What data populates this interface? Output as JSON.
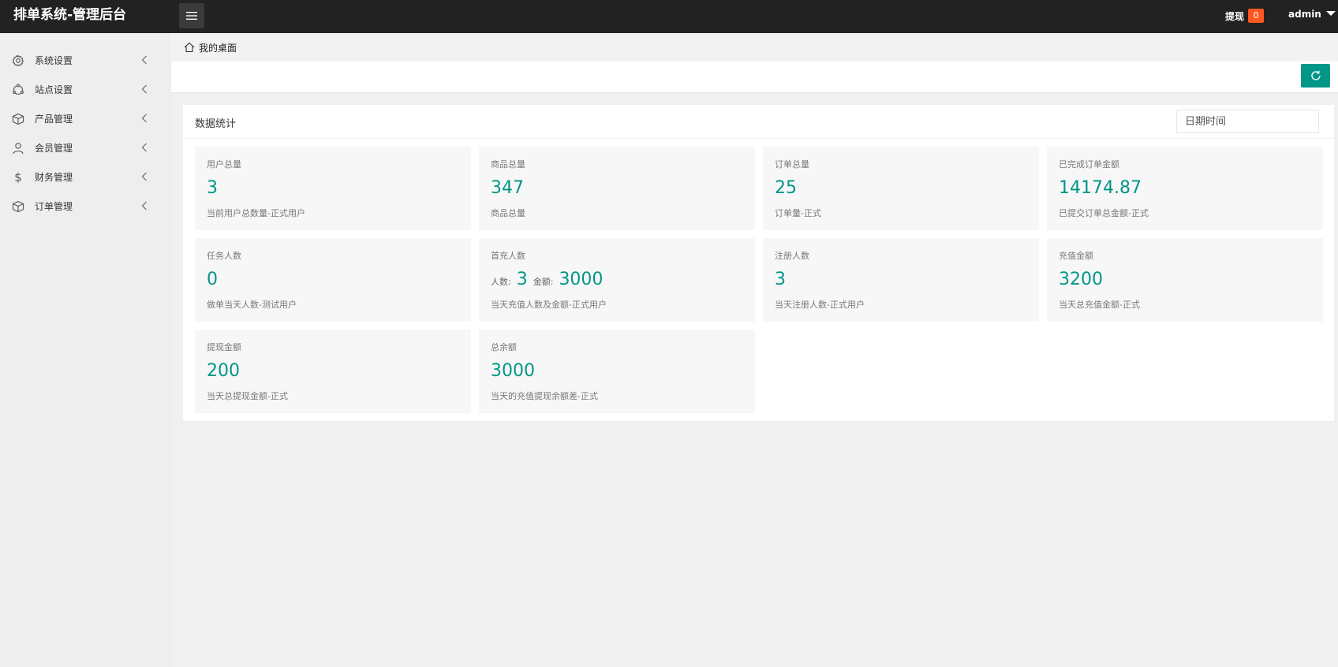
{
  "header": {
    "title": "排单系统-管理后台",
    "withdraw_label": "提现",
    "withdraw_count": "0",
    "user_name": "admin"
  },
  "sidebar": {
    "items": [
      {
        "label": "系统设置",
        "icon": "gear-icon"
      },
      {
        "label": "站点设置",
        "icon": "site-icon"
      },
      {
        "label": "产品管理",
        "icon": "box-icon"
      },
      {
        "label": "会员管理",
        "icon": "user-icon"
      },
      {
        "label": "财务管理",
        "icon": "dollar-icon"
      },
      {
        "label": "订单管理",
        "icon": "order-box-icon"
      }
    ]
  },
  "breadcrumb": {
    "label": "我的桌面"
  },
  "panel": {
    "title": "数据统计",
    "date_placeholder": "日期时间"
  },
  "stats": [
    {
      "title": "用户总量",
      "value": "3",
      "desc": "当前用户总数量-正式用户"
    },
    {
      "title": "商品总量",
      "value": "347",
      "desc": "商品总量"
    },
    {
      "title": "订单总量",
      "value": "25",
      "desc": "订单量-正式"
    },
    {
      "title": "已完成订单金额",
      "value": "14174.87",
      "desc": "已提交订单总金额-正式"
    },
    {
      "title": "任务人数",
      "value": "0",
      "desc": "做单当天人数-测试用户"
    },
    {
      "title": "首充人数",
      "people_label": "人数:",
      "people_value": "3",
      "amount_label": "金额:",
      "amount_value": "3000",
      "desc": "当天充值人数及金额-正式用户"
    },
    {
      "title": "注册人数",
      "value": "3",
      "desc": "当天注册人数-正式用户"
    },
    {
      "title": "充值金额",
      "value": "3200",
      "desc": "当天总充值金额-正式"
    },
    {
      "title": "提现金额",
      "value": "200",
      "desc": "当天总提现金额-正式"
    },
    {
      "title": "总余额",
      "value": "3000",
      "desc": "当天的充值提现余额差-正式"
    }
  ],
  "colors": {
    "accent": "#009688",
    "header_bg": "#222222",
    "badge": "#ff5722"
  }
}
